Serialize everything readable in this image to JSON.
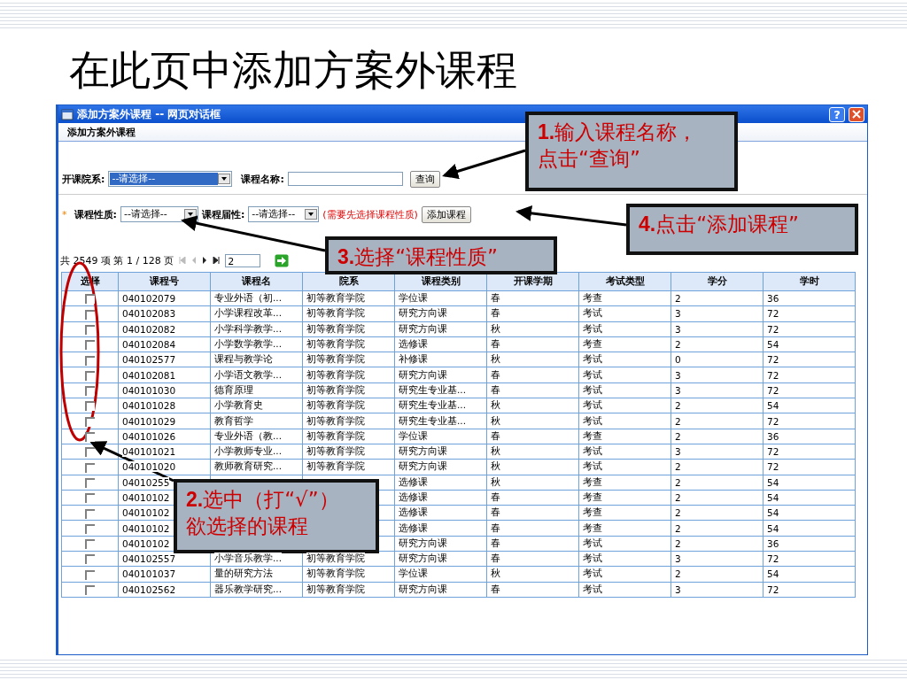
{
  "slide_title": "在此页中添加方案外课程",
  "dialog": {
    "title": "添加方案外课程 -- 网页对话框",
    "help_button": "?",
    "heading": "添加方案外课程",
    "filters_row_1": {
      "department_label": "开课院系:",
      "department_value": "--请选择--",
      "course_name_label": "课程名称:",
      "query_button": "查询"
    },
    "filters_row_2": {
      "required_mark": "*",
      "nature_label": "课程性质:",
      "nature_value": "--请选择--",
      "attribute_label": "课程届性:",
      "attribute_value": "--请选择--",
      "hint": "(需要先选择课程性质)",
      "add_button": "添加课程"
    },
    "pager": {
      "summary": "共 2549 项 第 1 / 128 页",
      "page_input": "2"
    },
    "table": {
      "select_column": "选择",
      "columns": [
        "课程号",
        "课程名",
        "院系",
        "课程类别",
        "开课学期",
        "考试类型",
        "学分",
        "学时"
      ],
      "rows": [
        {
          "checked": false,
          "cells": [
            "040102079",
            "专业外语（初...",
            "初等教育学院",
            "学位课",
            "春",
            "考查",
            "2",
            "36"
          ]
        },
        {
          "checked": false,
          "cells": [
            "040102083",
            "小学课程改革...",
            "初等教育学院",
            "研究方向课",
            "春",
            "考试",
            "3",
            "72"
          ]
        },
        {
          "checked": false,
          "cells": [
            "040102082",
            "小学科学教学...",
            "初等教育学院",
            "研究方向课",
            "秋",
            "考试",
            "3",
            "72"
          ]
        },
        {
          "checked": false,
          "cells": [
            "040102084",
            "小学数学教学...",
            "初等教育学院",
            "选修课",
            "春",
            "考查",
            "2",
            "54"
          ]
        },
        {
          "checked": false,
          "cells": [
            "040102577",
            "课程与教学论",
            "初等教育学院",
            "补修课",
            "秋",
            "考试",
            "0",
            "72"
          ]
        },
        {
          "checked": false,
          "cells": [
            "040102081",
            "小学语文教学...",
            "初等教育学院",
            "研究方向课",
            "春",
            "考试",
            "3",
            "72"
          ]
        },
        {
          "checked": false,
          "cells": [
            "040101030",
            "德育原理",
            "初等教育学院",
            "研究生专业基...",
            "春",
            "考试",
            "3",
            "72"
          ]
        },
        {
          "checked": false,
          "cells": [
            "040101028",
            "小学教育史",
            "初等教育学院",
            "研究生专业基...",
            "秋",
            "考试",
            "2",
            "54"
          ]
        },
        {
          "checked": false,
          "cells": [
            "040101029",
            "教育哲学",
            "初等教育学院",
            "研究生专业基...",
            "秋",
            "考试",
            "2",
            "72"
          ]
        },
        {
          "checked": false,
          "cells": [
            "040101026",
            "专业外语（教...",
            "初等教育学院",
            "学位课",
            "春",
            "考查",
            "2",
            "36"
          ]
        },
        {
          "checked": false,
          "cells": [
            "040101021",
            "小学教师专业...",
            "初等教育学院",
            "研究方向课",
            "秋",
            "考试",
            "3",
            "72"
          ]
        },
        {
          "checked": false,
          "cells": [
            "040101020",
            "教师教育研究...",
            "初等教育学院",
            "研究方向课",
            "秋",
            "考试",
            "2",
            "72"
          ]
        },
        {
          "checked": false,
          "cells": [
            "04010255",
            null,
            null,
            "选修课",
            "秋",
            "考查",
            "2",
            "54"
          ]
        },
        {
          "checked": false,
          "cells": [
            "04010102",
            null,
            null,
            "选修课",
            "春",
            "考查",
            "2",
            "54"
          ]
        },
        {
          "checked": false,
          "cells": [
            "04010102",
            null,
            null,
            "选修课",
            "春",
            "考查",
            "2",
            "54"
          ]
        },
        {
          "checked": false,
          "cells": [
            "04010102",
            null,
            null,
            "选修课",
            "春",
            "考查",
            "2",
            "54"
          ]
        },
        {
          "checked": false,
          "cells": [
            "04010102",
            null,
            null,
            "研究方向课",
            "春",
            "考试",
            "2",
            "36"
          ]
        },
        {
          "checked": false,
          "cells": [
            "040102557",
            "小学音乐教学...",
            "初等教育学院",
            "研究方向课",
            "春",
            "考试",
            "3",
            "72"
          ]
        },
        {
          "checked": false,
          "cells": [
            "040101037",
            "量的研究方法",
            "初等教育学院",
            "学位课",
            "秋",
            "考试",
            "2",
            "54"
          ]
        },
        {
          "checked": false,
          "cells": [
            "040102562",
            "器乐教学研究...",
            "初等教育学院",
            "研究方向课",
            "春",
            "考试",
            "3",
            "72"
          ]
        }
      ]
    }
  },
  "callouts": [
    {
      "lines": [
        "**1.**输入课程名称，",
        "点击“查询”"
      ]
    },
    {
      "lines": [
        "**2.**选中（打“√”）",
        "欲选择的课程"
      ]
    },
    {
      "lines": [
        "**3.**选择“课程性质”"
      ]
    },
    {
      "lines": [
        "**4.**点击“添加课程”"
      ]
    }
  ]
}
